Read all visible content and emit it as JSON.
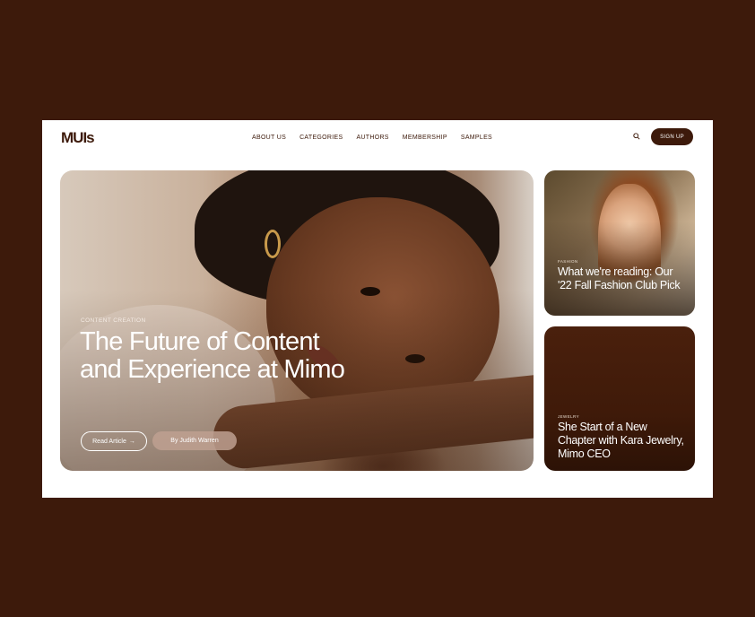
{
  "header": {
    "logo": "MUIs",
    "nav": [
      "ABOUT US",
      "CATEGORIES",
      "AUTHORS",
      "MEMBERSHIP",
      "SAMPLES"
    ],
    "signup_label": "SIGN UP",
    "search_icon": "search-icon"
  },
  "hero": {
    "category": "CONTENT CREATION",
    "title": "The Future of Content and Experience at Mimo",
    "read_label": "Read Article",
    "read_arrow": "→",
    "author": "By Judith Warren"
  },
  "cards": [
    {
      "category": "FASHION",
      "title": "What we're reading: Our '22 Fall Fashion Club Pick"
    },
    {
      "category": "JEWELRY",
      "title": "She Start of a New Chapter with Kara Jewelry, Mimo CEO"
    }
  ],
  "colors": {
    "background": "#3d1a0b",
    "brand": "#3d1a0b",
    "surface": "#ffffff"
  }
}
